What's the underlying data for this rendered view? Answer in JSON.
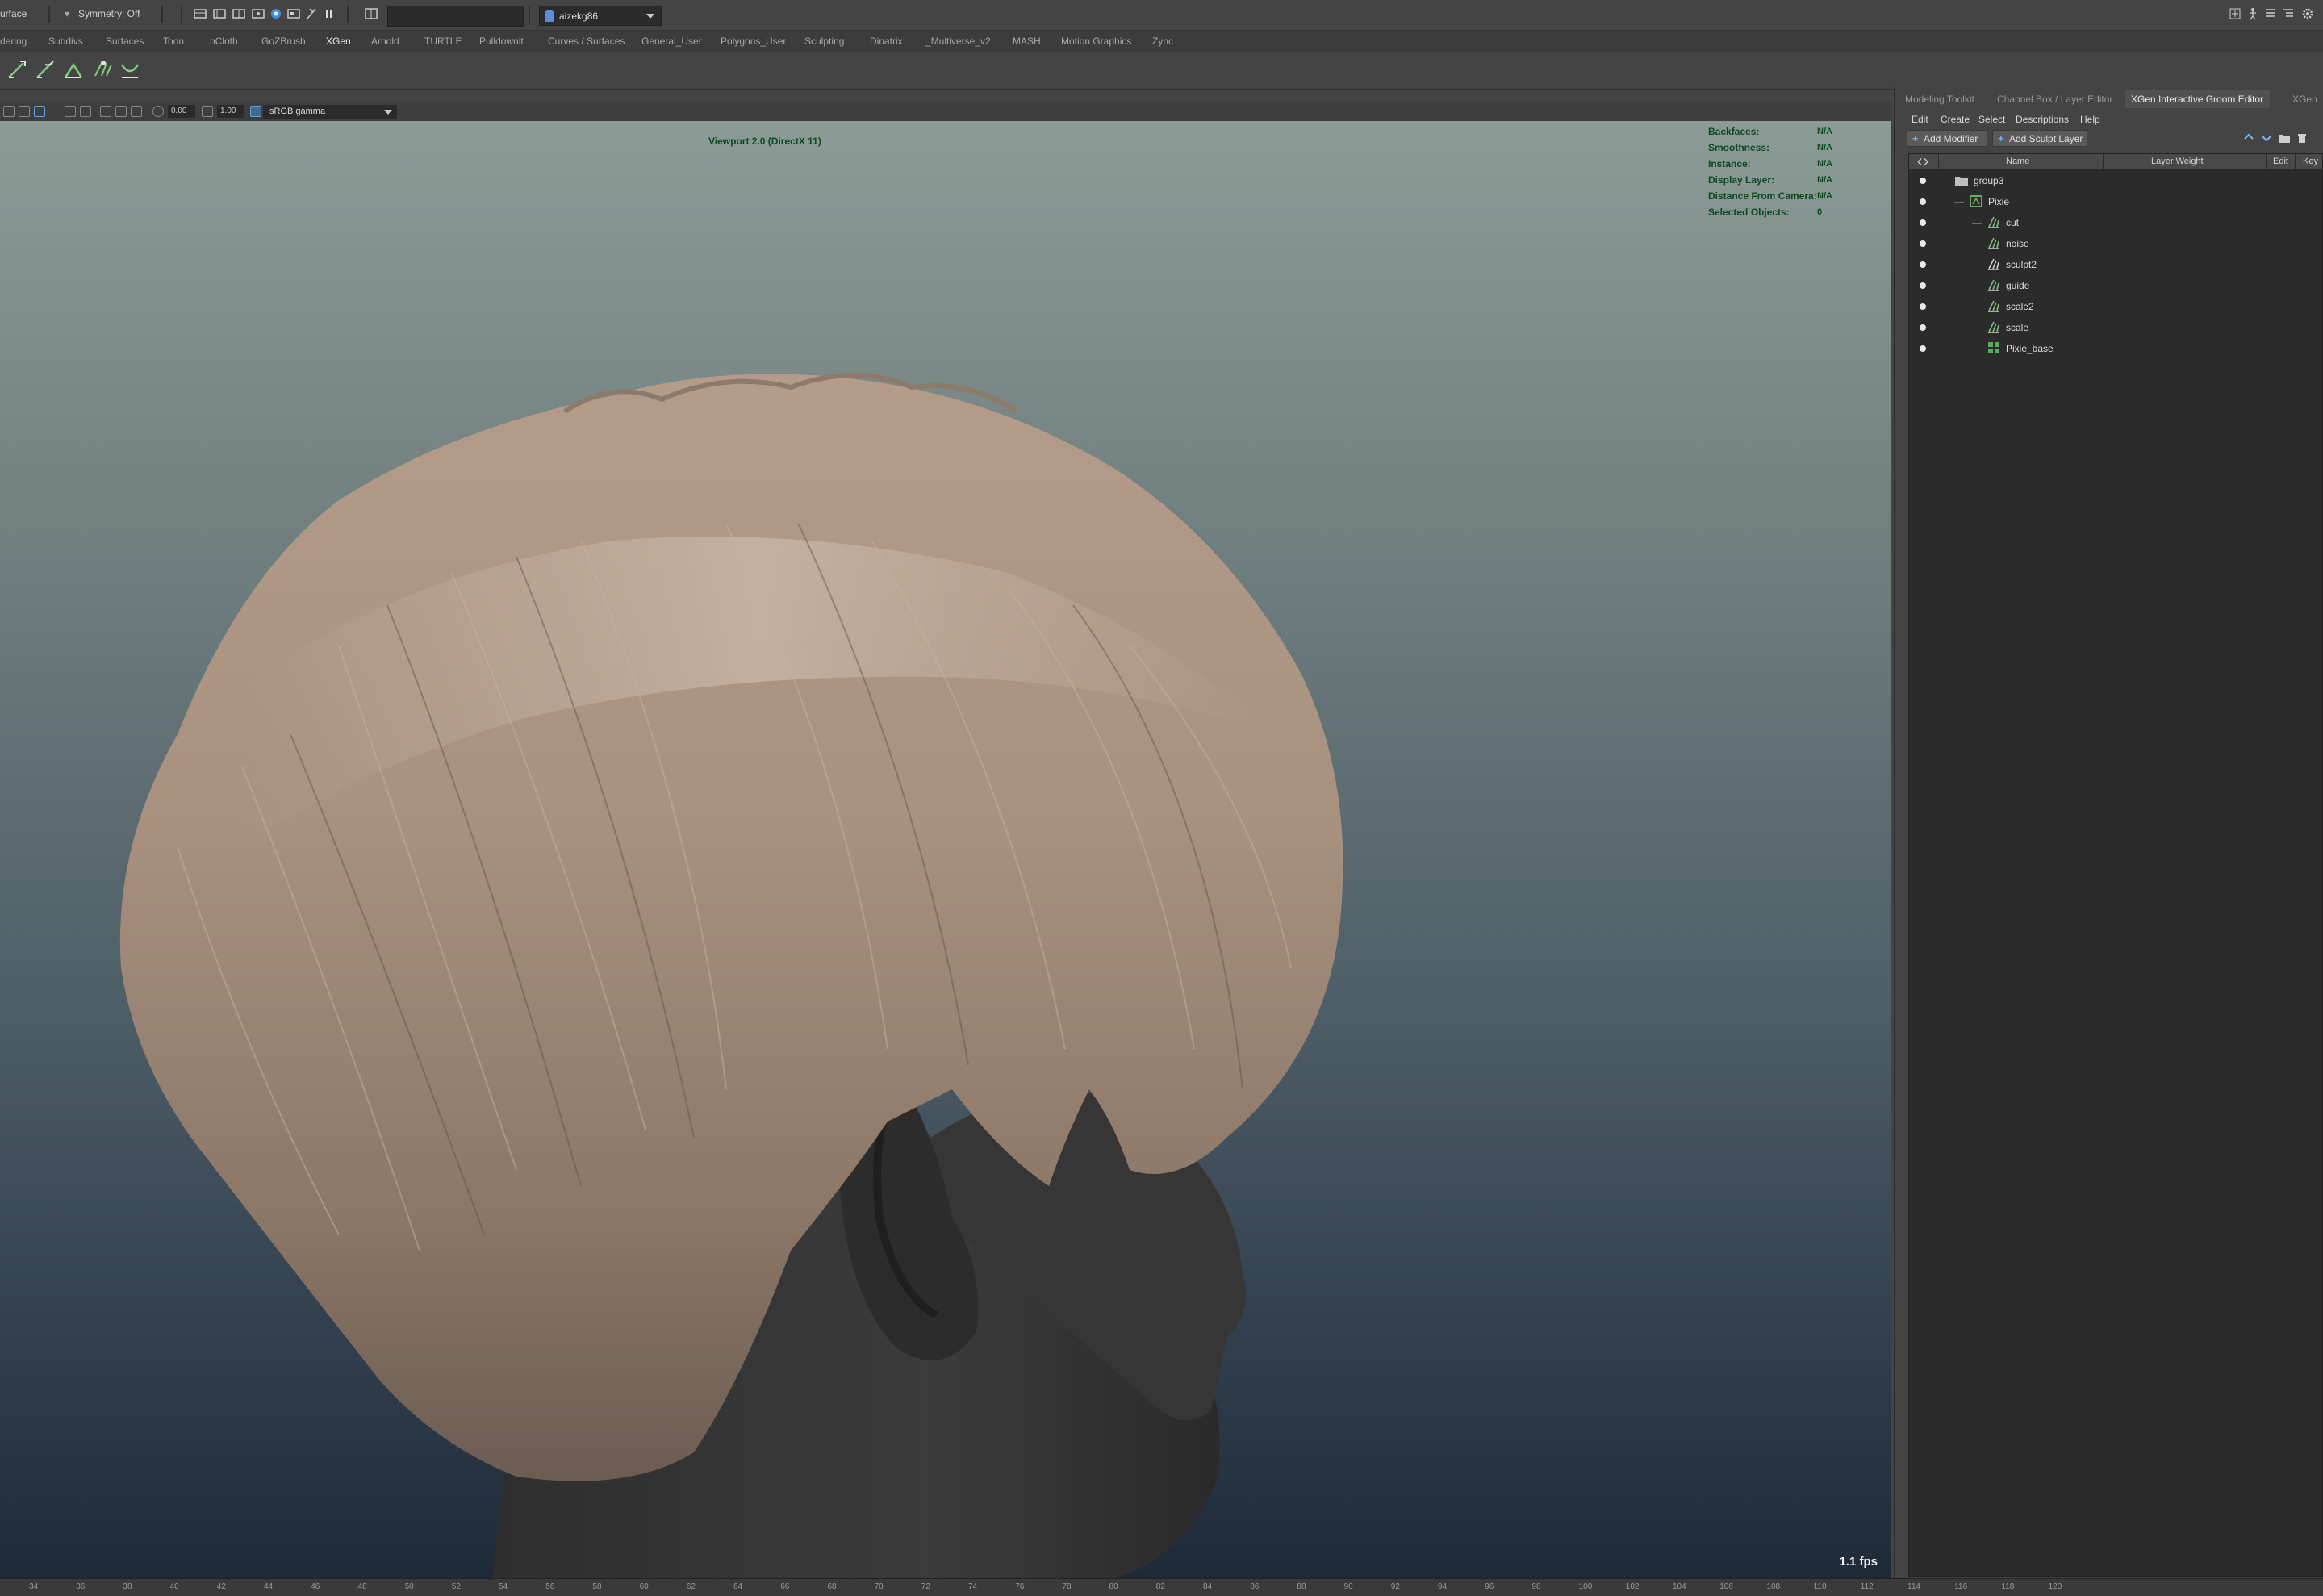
{
  "statusline": {
    "mode_label": "urface",
    "symmetry_label": "Symmetry: Off",
    "search_value": "",
    "user_name": "aizekg86"
  },
  "shelf": {
    "tabs": [
      "dering",
      "Subdivs",
      "Surfaces",
      "Toon",
      "nCloth",
      "GoZBrush",
      "XGen",
      "Arnold",
      "TURTLE",
      "Pulldownit",
      "Curves / Surfaces",
      "General_User",
      "Polygons_User",
      "Sculpting",
      "Dinatrix",
      "_Multiverse_v2",
      "MASH",
      "Motion Graphics",
      "Zync"
    ],
    "active_tab": "XGen",
    "tool_icons": [
      "groom-brush-1-icon",
      "groom-brush-2-icon",
      "groom-brush-3-icon",
      "groom-brush-4-icon",
      "groom-brush-5-icon"
    ]
  },
  "viewport_toolbar": {
    "exposure": "0.00",
    "gamma": "1.00",
    "color_space": "sRGB gamma"
  },
  "viewport": {
    "title": "Viewport 2.0 (DirectX 11)",
    "hud": [
      {
        "label": "Backfaces:",
        "value": "N/A"
      },
      {
        "label": "Smoothness:",
        "value": "N/A"
      },
      {
        "label": "Instance:",
        "value": "N/A"
      },
      {
        "label": "Display Layer:",
        "value": "N/A"
      },
      {
        "label": "Distance From Camera:",
        "value": "N/A"
      },
      {
        "label": "Selected Objects:",
        "value": "0"
      }
    ],
    "fps": "1.1 fps",
    "colors": {
      "hair": "#a0887a",
      "skin": "#3a3a3a",
      "hud_text": "#0c4a22"
    }
  },
  "timeline": {
    "ticks": [
      "34",
      "36",
      "38",
      "40",
      "42",
      "44",
      "46",
      "48",
      "50",
      "52",
      "54",
      "56",
      "58",
      "60",
      "62",
      "64",
      "66",
      "68",
      "70",
      "72",
      "74",
      "76",
      "78",
      "80",
      "82",
      "84",
      "86",
      "88",
      "90",
      "92",
      "94",
      "96",
      "98",
      "100",
      "102",
      "104",
      "106",
      "108",
      "110",
      "112",
      "114",
      "116",
      "118",
      "120"
    ]
  },
  "right_panel": {
    "tabs": [
      "Modeling Toolkit",
      "Channel Box / Layer Editor",
      "XGen Interactive Groom Editor",
      "XGen"
    ],
    "active_tab": "XGen Interactive Groom Editor",
    "menu": [
      "Edit",
      "Create",
      "Select",
      "Descriptions",
      "Help"
    ],
    "buttons": {
      "add_modifier": "Add Modifier",
      "add_sculpt_layer": "Add Sculpt Layer"
    },
    "columns": {
      "name": "Name",
      "layer_weight": "Layer Weight",
      "edit": "Edit",
      "key": "Key"
    },
    "tree": [
      {
        "name": "group3",
        "icon": "folder-icon"
      },
      {
        "name": "Pixie",
        "icon": "description-icon"
      },
      {
        "name": "cut",
        "icon": "cut-modifier-icon"
      },
      {
        "name": "noise",
        "icon": "noise-modifier-icon"
      },
      {
        "name": "sculpt2",
        "icon": "sculpt-modifier-icon"
      },
      {
        "name": "guide",
        "icon": "guide-modifier-icon"
      },
      {
        "name": "scale2",
        "icon": "scale-modifier-icon"
      },
      {
        "name": "scale",
        "icon": "scale-modifier-icon"
      },
      {
        "name": "Pixie_base",
        "icon": "base-grid-icon"
      }
    ]
  }
}
